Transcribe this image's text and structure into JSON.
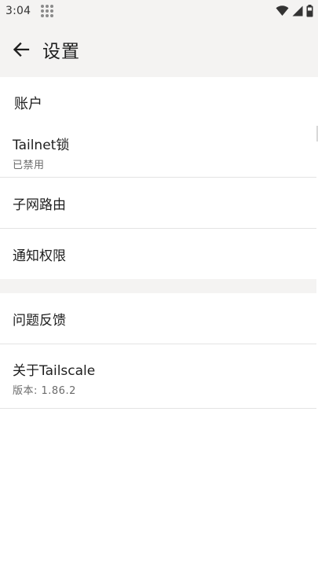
{
  "status_bar": {
    "time": "3:04",
    "icons": [
      "app-grid-icon",
      "wifi-icon",
      "cell-signal-icon",
      "battery-icon"
    ]
  },
  "app_bar": {
    "back_icon": "arrow-left-icon",
    "title": "设置"
  },
  "sections": {
    "account": {
      "header": "账户",
      "tailnet_lock": {
        "title": "Tailnet锁",
        "subtitle": "已禁用"
      },
      "subnet_routing": {
        "title": "子网路由"
      },
      "notification_permissions": {
        "title": "通知权限"
      }
    },
    "other": {
      "feedback": {
        "title": "问题反馈"
      },
      "about": {
        "title": "关于Tailscale",
        "subtitle": "版本: 1.86.2"
      }
    }
  },
  "colors": {
    "surface": "#f4f3f2",
    "background": "#ffffff",
    "divider": "#e3e3e3",
    "text_primary": "#1e1e1e",
    "text_secondary": "#6b6b6b"
  }
}
